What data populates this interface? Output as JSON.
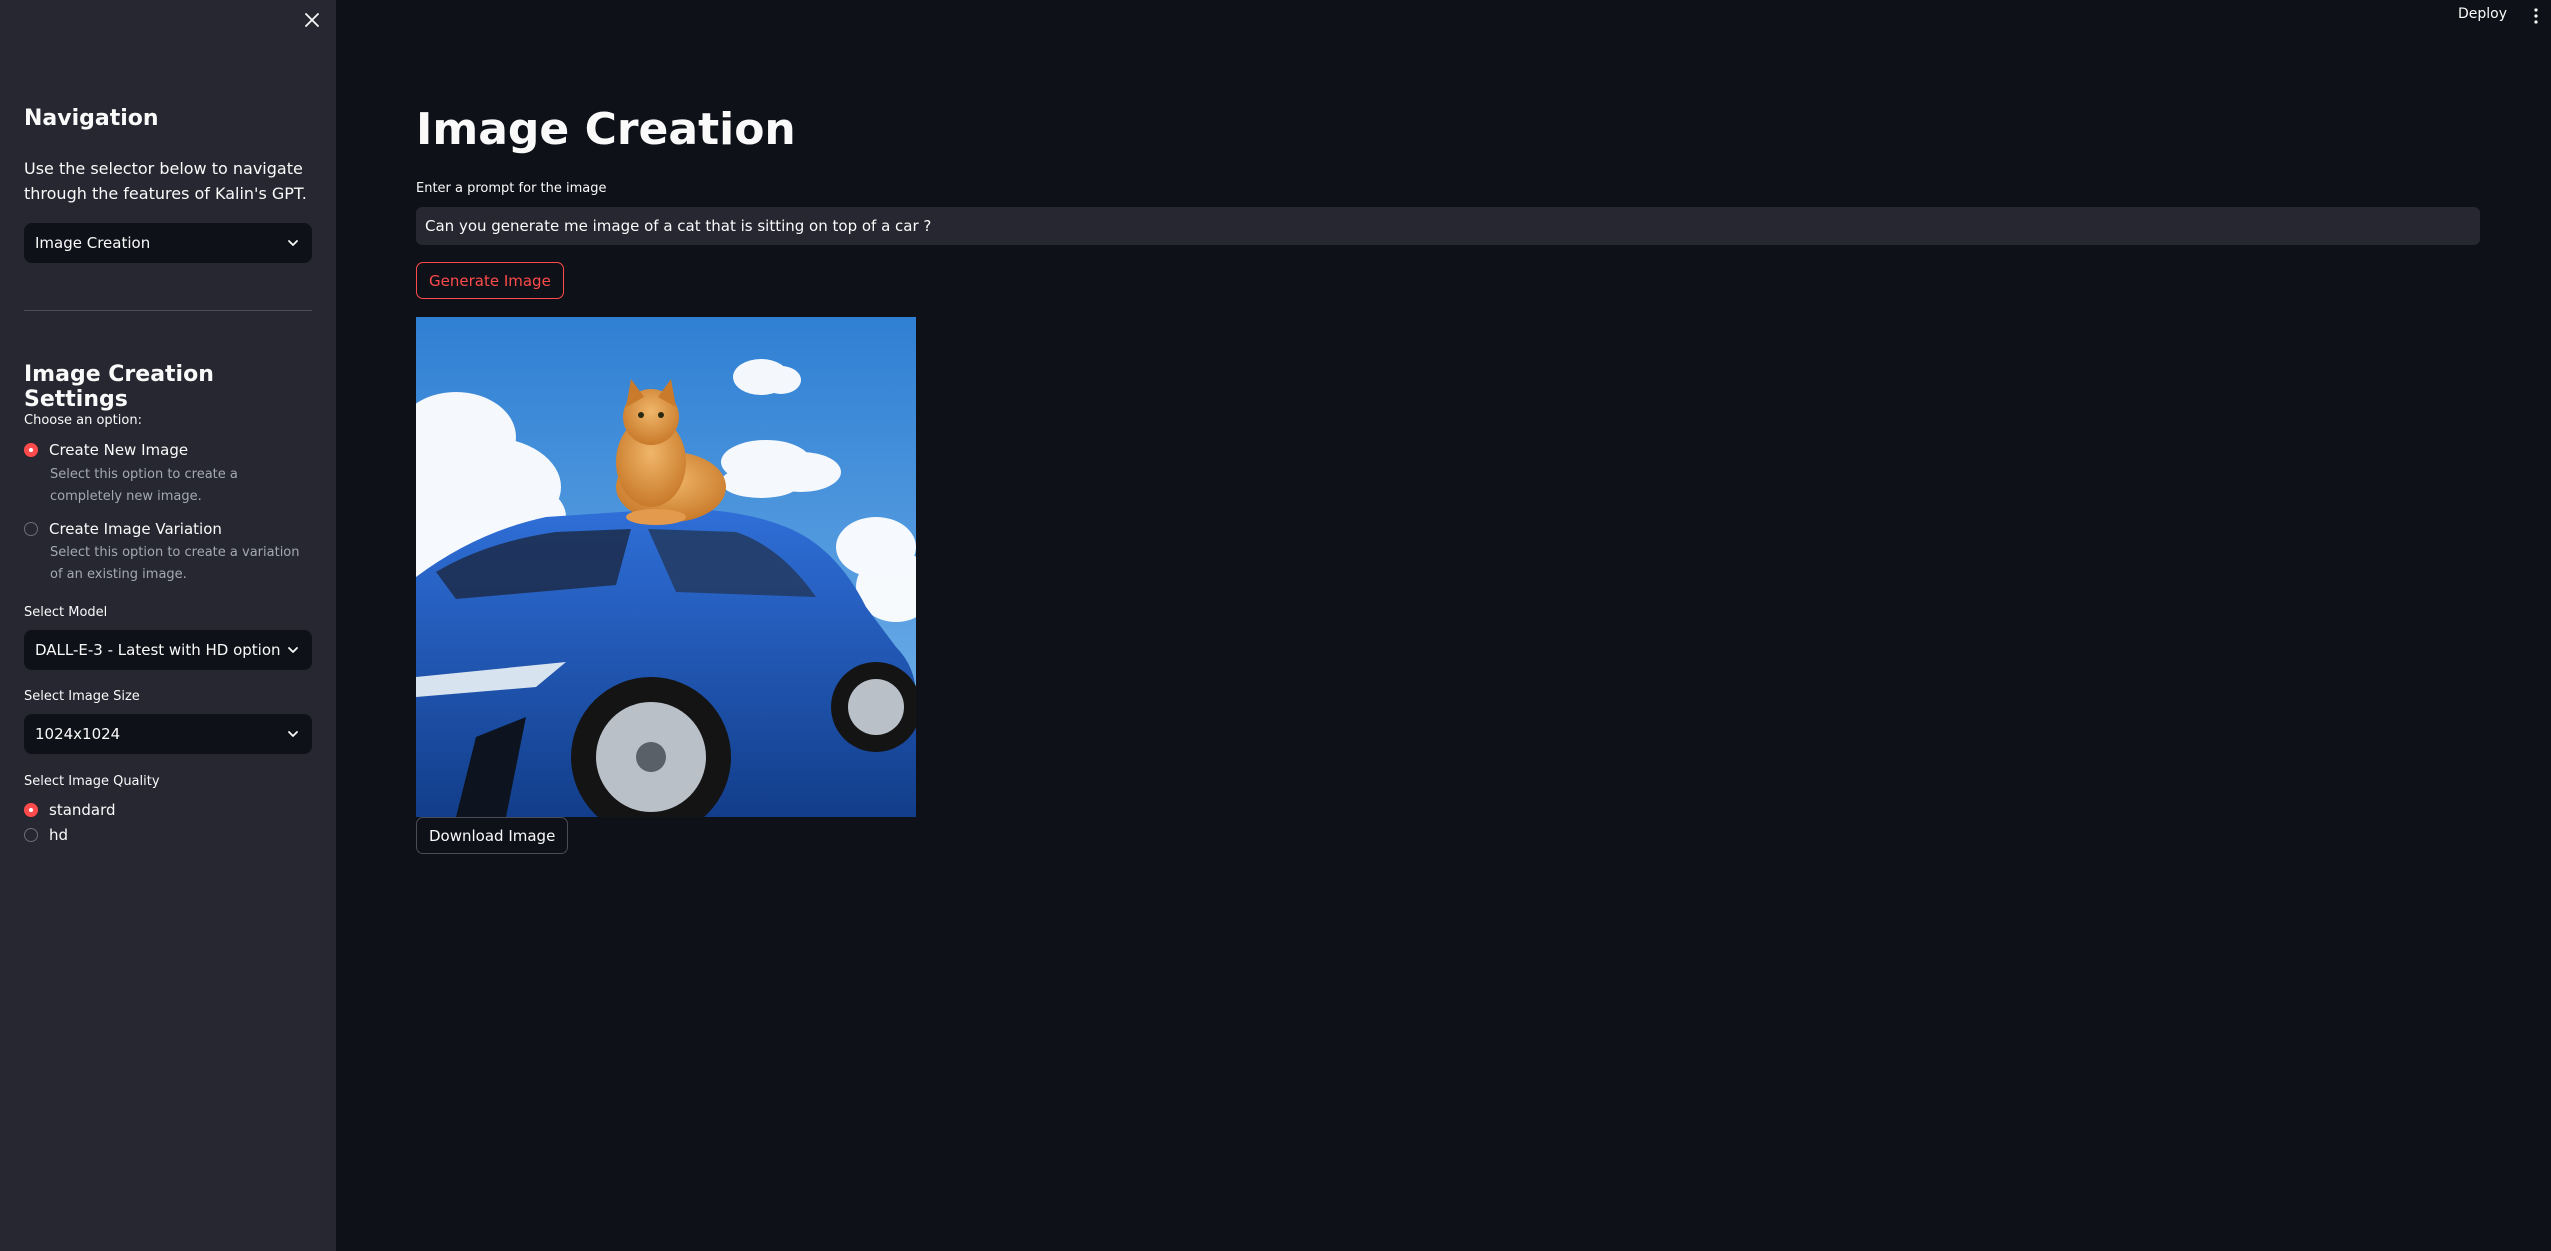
{
  "sidebar": {
    "close_icon": "close-icon",
    "navigation": {
      "title": "Navigation",
      "description": "Use the selector below to navigate through the features of Kalin's GPT.",
      "selected_page": "Image Creation"
    },
    "settings": {
      "title": "Image Creation Settings",
      "option_label": "Choose an option:",
      "options": [
        {
          "label": "Create New Image",
          "help": "Select this option to create a completely new image.",
          "selected": true
        },
        {
          "label": "Create Image Variation",
          "help": "Select this option to create a variation of an existing image.",
          "selected": false
        }
      ],
      "model": {
        "label": "Select Model",
        "value": "DALL-E-3 - Latest with HD option"
      },
      "size": {
        "label": "Select Image Size",
        "value": "1024x1024"
      },
      "quality": {
        "label": "Select Image Quality",
        "options": [
          {
            "label": "standard",
            "selected": true
          },
          {
            "label": "hd",
            "selected": false
          }
        ]
      }
    }
  },
  "header": {
    "deploy_label": "Deploy",
    "menu_icon": "vertical-dots-icon"
  },
  "main": {
    "title": "Image Creation",
    "prompt_label": "Enter a prompt for the image",
    "prompt_value": "Can you generate me image of a cat that is sitting on top of a car ?",
    "generate_button": "Generate Image",
    "download_button": "Download Image"
  },
  "colors": {
    "background": "#0e1117",
    "sidebar": "#262730",
    "accent": "#ff4b4b",
    "text": "#fafafa"
  }
}
